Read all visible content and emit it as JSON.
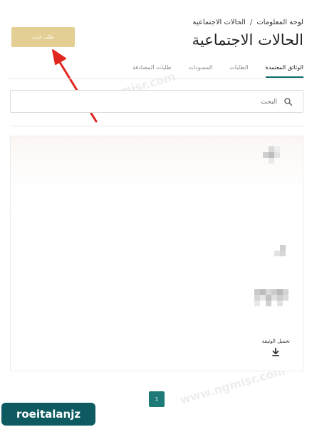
{
  "breadcrumb": {
    "items": [
      "لوحة المعلومات",
      "الحالات الاجتماعية"
    ],
    "separator": "/"
  },
  "page_title": "الحالات الاجتماعية",
  "new_request_label": "طلب جديد",
  "tabs": [
    {
      "label": "الوثائق المعتمدة",
      "active": true
    },
    {
      "label": "الطلبات",
      "active": false
    },
    {
      "label": "المسودات",
      "active": false
    },
    {
      "label": "طلبات المصادقة",
      "active": false
    }
  ],
  "search": {
    "placeholder": "البحث",
    "value": ""
  },
  "card": {
    "download_label": "تحميل الوثيقة"
  },
  "pagination": {
    "current_page": "1"
  },
  "overlay": {
    "watermark": "www.ngmisr.com",
    "channel_badge": "roeitalanjz"
  },
  "colors": {
    "accent": "#0f6c67",
    "button_gold": "#e3cf93",
    "arrow_red": "#e0261e",
    "badge_bg": "#0d5b60"
  },
  "icons": {
    "search": "search-icon",
    "download": "download-icon",
    "arrow": "red-arrow-annotation"
  }
}
